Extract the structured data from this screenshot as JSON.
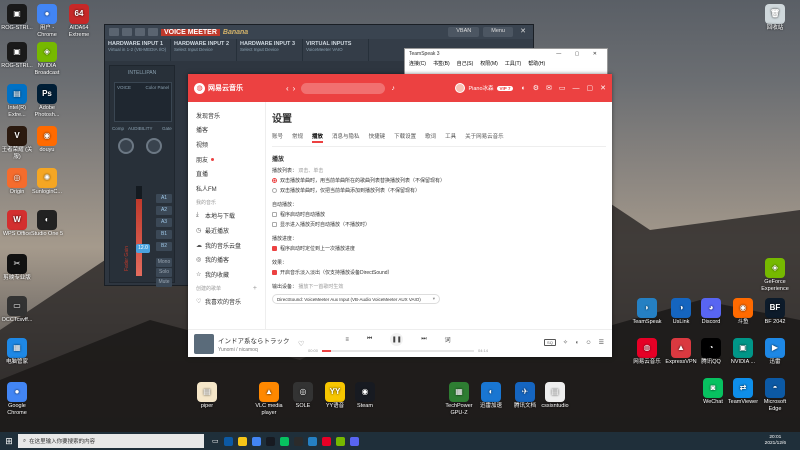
{
  "desktop": {
    "left_icons": [
      {
        "label": "ROG-STRI...",
        "color": "#1a1a1a",
        "glyph": "▣"
      },
      {
        "label": "用户 - Chrome",
        "color": "#4285f4",
        "glyph": "●"
      },
      {
        "label": "AIDA64 Extreme",
        "color": "#c62828",
        "glyph": "64"
      },
      {
        "label": "ROG-STRI...",
        "color": "#1a1a1a",
        "glyph": "▣"
      },
      {
        "label": "NVIDIA Broadcast",
        "color": "#76b900",
        "glyph": "◈"
      },
      {
        "label": "Intel(R) Extre...",
        "color": "#0071c5",
        "glyph": "▤"
      },
      {
        "label": "Adobe Photosh...",
        "color": "#001e36",
        "glyph": "Ps"
      },
      {
        "label": "王者荣耀 (关服)",
        "color": "#2b1a0f",
        "glyph": "V"
      },
      {
        "label": "douyu",
        "color": "#ff6a00",
        "glyph": "◉"
      },
      {
        "label": "Origin",
        "color": "#f56c2d",
        "glyph": "◎"
      },
      {
        "label": "SunloginC...",
        "color": "#f5a623",
        "glyph": "✺"
      },
      {
        "label": "WPS Office",
        "color": "#d32f2f",
        "glyph": "W"
      },
      {
        "label": "Studio One 5",
        "color": "#222",
        "glyph": "◐"
      },
      {
        "label": "剪映专业版",
        "color": "#111",
        "glyph": "✂"
      },
      {
        "label": "OCCTcsvff...",
        "color": "#333",
        "glyph": "▭"
      },
      {
        "label": "电脑管家",
        "color": "#1e88e5",
        "glyph": "▦"
      },
      {
        "label": "Google Chrome",
        "color": "#4285f4",
        "glyph": "●"
      }
    ],
    "right_icons": [
      {
        "label": "回收站",
        "color": "#cfd8dc",
        "glyph": "🗑"
      },
      {
        "label": "GeForce Experience",
        "color": "#76b900",
        "glyph": "◈"
      },
      {
        "label": "TeamSpeak",
        "color": "#2580c3",
        "glyph": "◗"
      },
      {
        "label": "UsLink",
        "color": "#1565c0",
        "glyph": "◑"
      },
      {
        "label": "Discord",
        "color": "#5865f2",
        "glyph": "◕"
      },
      {
        "label": "斗鱼",
        "color": "#ff6a00",
        "glyph": "◉"
      },
      {
        "label": "BF 2042",
        "color": "#0d1b2a",
        "glyph": "BF"
      },
      {
        "label": "网易云音乐",
        "color": "#e60026",
        "glyph": "◍"
      },
      {
        "label": "ExpressVPN",
        "color": "#da3940",
        "glyph": "▲"
      },
      {
        "label": "腾讯QQ",
        "color": "#000",
        "glyph": "◔"
      },
      {
        "label": "NVIDIA ...",
        "color": "#009688",
        "glyph": "▣"
      },
      {
        "label": "迅雷",
        "color": "#1e88e5",
        "glyph": "▶"
      },
      {
        "label": "WeChat",
        "color": "#07c160",
        "glyph": "◙"
      },
      {
        "label": "TeamViewer",
        "color": "#0e8ee9",
        "glyph": "⇄"
      },
      {
        "label": "Microsoft Edge",
        "color": "#0c59a4",
        "glyph": "◓"
      }
    ],
    "bottom_icons": [
      {
        "label": "piper",
        "color": "#f5e6c8",
        "glyph": "▤"
      },
      {
        "label": "VLC media player",
        "color": "#ff8800",
        "glyph": "▲"
      },
      {
        "label": "SOLE",
        "color": "#333",
        "glyph": "◎"
      },
      {
        "label": "YY语音",
        "color": "#f7c600",
        "glyph": "YY"
      },
      {
        "label": "Steam",
        "color": "#171a21",
        "glyph": "◉"
      },
      {
        "label": "TechPower GPU-Z",
        "color": "#2e7d32",
        "glyph": "▦"
      },
      {
        "label": "迅雷加速",
        "color": "#1976d2",
        "glyph": "◐"
      },
      {
        "label": "腾讯文档",
        "color": "#1565c0",
        "glyph": "✈"
      },
      {
        "label": "cssisntudio",
        "color": "#eeeeee",
        "glyph": "▤"
      }
    ]
  },
  "voicemeeter": {
    "logo": "VOICE MEETER",
    "logo2": "Banana",
    "btn_vban": "VBAN",
    "btn_menu": "Menu",
    "headers": [
      {
        "title": "HARDWARE INPUT 1",
        "sub": "Virtual in 1-2 (VB-MEDIA I/O)"
      },
      {
        "title": "HARDWARE INPUT 2",
        "sub": "Select Input Device"
      },
      {
        "title": "HARDWARE INPUT 3",
        "sub": "Select Input Device"
      },
      {
        "title": "VIRTUAL INPUTS",
        "sub": "VoiceMeeter VAIO"
      }
    ],
    "gain": "12.0",
    "fader_label": "Fader Gain",
    "bus_buttons": [
      "A1",
      "A2",
      "A3",
      "B1",
      "B2"
    ],
    "strip_buttons": [
      "Mono",
      "Solo",
      "Mute"
    ],
    "labels": [
      "INTELLIPAN",
      "VOICE",
      "Color Panel",
      "Comp",
      "AUDIBILITY",
      "Gate"
    ],
    "fader_level": 0.86
  },
  "teamspeak": {
    "title": "TeamSpeak 3",
    "menu": [
      "连接(C)",
      "书签(B)",
      "自己(S)",
      "权限(M)",
      "工具(T)",
      "帮助(H)"
    ]
  },
  "netease": {
    "app_name": "网易云音乐",
    "user_name": "Piano冰森",
    "vip": "VIP 7",
    "sidebar": [
      {
        "label": "发现音乐",
        "icon": ""
      },
      {
        "label": "播客",
        "icon": ""
      },
      {
        "label": "视频",
        "icon": ""
      },
      {
        "label": "朋友",
        "icon": "dot"
      },
      {
        "label": "直播",
        "icon": ""
      },
      {
        "label": "私人FM",
        "icon": ""
      }
    ],
    "sidebar_head1": "我的音乐",
    "sidebar_mine": [
      {
        "label": "本地与下载",
        "icon": "⤓"
      },
      {
        "label": "最近播放",
        "icon": "◷"
      },
      {
        "label": "我的音乐云盘",
        "icon": "☁"
      },
      {
        "label": "我的播客",
        "icon": "◎"
      },
      {
        "label": "我的收藏",
        "icon": "☆"
      }
    ],
    "sidebar_head2": "创建的歌单",
    "sidebar_liked": "我喜欢的音乐",
    "page_title": "设置",
    "tabs": [
      "账号",
      "常规",
      "播放",
      "消息与隐私",
      "快捷键",
      "下载设置",
      "歌词",
      "工具",
      "关于网易云音乐"
    ],
    "active_tab": 2,
    "section": "播放",
    "group1_title": "播放列表：",
    "group1_hint": "双击、单击",
    "radio1": "双击播放单曲时，用当前单曲所在的歌曲列表替换播放列表（不保留现有）",
    "radio2": "双击播放单曲时，仅把当前单曲添加到播放列表（不保留现有）",
    "group2_title": "自动播放：",
    "check1": "程序启动时自动播放",
    "check2": "显示进入播放页时自动播放（不播放时）",
    "group3_title": "播放进度：",
    "check3": "程序启动时定位到上一次播放进度",
    "group4_title": "效果：",
    "check4": "开启音乐淡入淡出（仅支持播放设备DirectSound）",
    "group5_title": "输出设备：",
    "group5_hint": "播放下一首歌时生效",
    "output_device": "DirectSound: VoiceMeeter Aux Input (VB-Audio VoiceMeeter AUX VAIO)",
    "song_title": "インドア系ならトラック",
    "song_artist": "Yunomi / nicamoq",
    "time_current": "00:00",
    "time_total": "04:14",
    "progress": 0.06,
    "sq_label": "SQ"
  },
  "taskbar": {
    "search_placeholder": "在这里输入你要搜索的内容",
    "time": "20:01",
    "date": "2021/12/6"
  }
}
